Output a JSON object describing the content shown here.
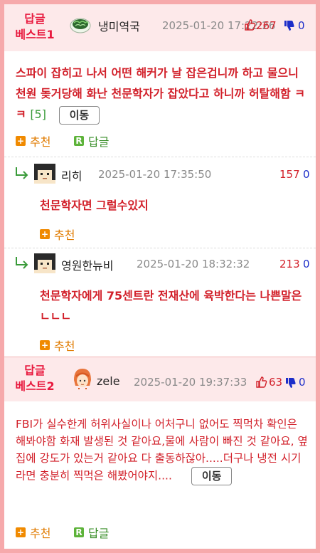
{
  "best1": {
    "badge_line1": "답글",
    "badge_line2": "베스트1",
    "nick": "냉미역국",
    "date": "2025-01-20 17:22:26",
    "up": "267",
    "down": "0",
    "body": "스파이 잡히고 나서 어떤 해커가 날 잡은겁니까 하고 물으니 천원 돚거당해 화난 천문학자가 잡았다고 하니까 허탈해함 ㅋㅋ",
    "count": "[5]",
    "move_label": "이동",
    "recommend_label": "추천",
    "reply_label": "답글"
  },
  "replies": [
    {
      "nick": "리히",
      "date": "2025-01-20 17:35:50",
      "up": "157",
      "down": "0",
      "body": "천문학자면 그럴수있지",
      "recommend_label": "추천"
    },
    {
      "nick": "영원한뉴비",
      "date": "2025-01-20 18:32:32",
      "up": "213",
      "down": "0",
      "body": "천문학자에게 75센트란 전재산에 육박한다는 나쁜말은 ㄴㄴㄴ",
      "recommend_label": "추천"
    }
  ],
  "best2": {
    "badge_line1": "답글",
    "badge_line2": "베스트2",
    "nick": "zele",
    "date": "2025-01-20 19:37:33",
    "up": "63",
    "down": "0",
    "body": "FBI가 실수한게 허위사실이나 어처구니 없어도 찍먹차 확인은 해봐야함 화재 발생된 것 같아요,물에 사람이 빠진 것 같아요, 옆집에 강도가 있는거 같아요 다 출동하잖아.....더구나 냉전 시기라면 충분히 찍먹은 해봤어야지....",
    "move_label": "이동",
    "recommend_label": "추천",
    "reply_label": "답글"
  },
  "colors": {
    "frame": "#f6a9ab",
    "best_header_bg": "#fde9ea",
    "badge": "#e8193e",
    "upvote": "#d2202a",
    "downvote": "#1d2ec9"
  },
  "icons": {
    "thumbs_up": "thumbs-up-icon",
    "thumbs_down": "thumbs-down-icon",
    "reply_arrow": "reply-arrow-icon",
    "plus": "plus-icon",
    "reply_r": "reply-r-icon"
  }
}
